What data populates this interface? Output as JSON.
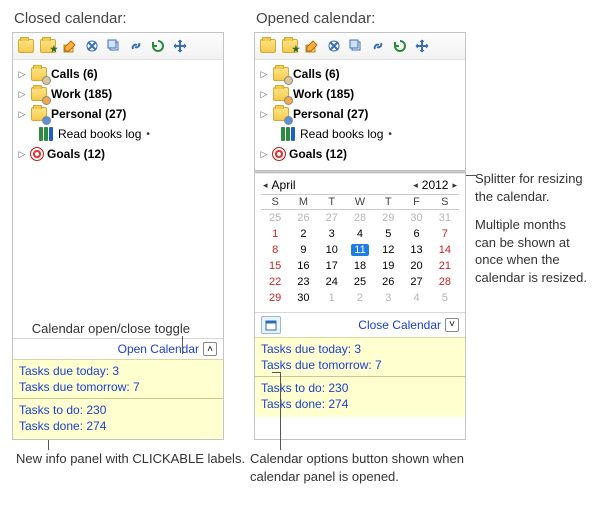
{
  "headings": {
    "closed": "Closed calendar:",
    "opened": "Opened calendar:"
  },
  "toolbar_icons": [
    "folder-icon",
    "new-folder-icon",
    "edit-icon",
    "cut-icon",
    "copy-icon",
    "link-icon",
    "refresh-icon",
    "move-icon"
  ],
  "tree": {
    "calls": {
      "label": "Calls (6)"
    },
    "work": {
      "label": "Work (185)"
    },
    "personal": {
      "label": "Personal (27)"
    },
    "books": {
      "label": "Read books log"
    },
    "goals": {
      "label": "Goals (12)"
    }
  },
  "toggle": {
    "open": "Open Calendar",
    "close": "Close Calendar"
  },
  "info": {
    "today": "Tasks due today: 3",
    "tomorrow": "Tasks due tomorrow: 7",
    "todo": "Tasks to do: 230",
    "done": "Tasks done: 274"
  },
  "calendar": {
    "month": "April",
    "year": "2012",
    "dow": [
      "S",
      "M",
      "T",
      "W",
      "T",
      "F",
      "S"
    ],
    "weeks": [
      [
        {
          "d": "25",
          "m": true
        },
        {
          "d": "26",
          "m": true
        },
        {
          "d": "27",
          "m": true
        },
        {
          "d": "28",
          "m": true
        },
        {
          "d": "29",
          "m": true
        },
        {
          "d": "30",
          "m": true
        },
        {
          "d": "31",
          "m": true
        }
      ],
      [
        {
          "d": "1",
          "w": true
        },
        {
          "d": "2"
        },
        {
          "d": "3"
        },
        {
          "d": "4"
        },
        {
          "d": "5"
        },
        {
          "d": "6"
        },
        {
          "d": "7",
          "w": true
        }
      ],
      [
        {
          "d": "8",
          "w": true
        },
        {
          "d": "9"
        },
        {
          "d": "10"
        },
        {
          "d": "11",
          "t": true
        },
        {
          "d": "12"
        },
        {
          "d": "13"
        },
        {
          "d": "14",
          "w": true
        }
      ],
      [
        {
          "d": "15",
          "w": true
        },
        {
          "d": "16"
        },
        {
          "d": "17"
        },
        {
          "d": "18"
        },
        {
          "d": "19"
        },
        {
          "d": "20"
        },
        {
          "d": "21",
          "w": true
        }
      ],
      [
        {
          "d": "22",
          "w": true
        },
        {
          "d": "23"
        },
        {
          "d": "24"
        },
        {
          "d": "25"
        },
        {
          "d": "26"
        },
        {
          "d": "27"
        },
        {
          "d": "28",
          "w": true
        }
      ],
      [
        {
          "d": "29",
          "w": true
        },
        {
          "d": "30"
        },
        {
          "d": "1",
          "m": true
        },
        {
          "d": "2",
          "m": true
        },
        {
          "d": "3",
          "m": true
        },
        {
          "d": "4",
          "m": true
        },
        {
          "d": "5",
          "m": true
        }
      ]
    ]
  },
  "annotations": {
    "toggle": "Calendar open/close toggle",
    "info": "New info panel with CLICKABLE labels.",
    "splitter": "Splitter for resizing the calendar.",
    "multi": "Multiple months can be shown at once when the calendar is resized.",
    "opts": "Calendar options button shown when calendar panel is opened."
  }
}
